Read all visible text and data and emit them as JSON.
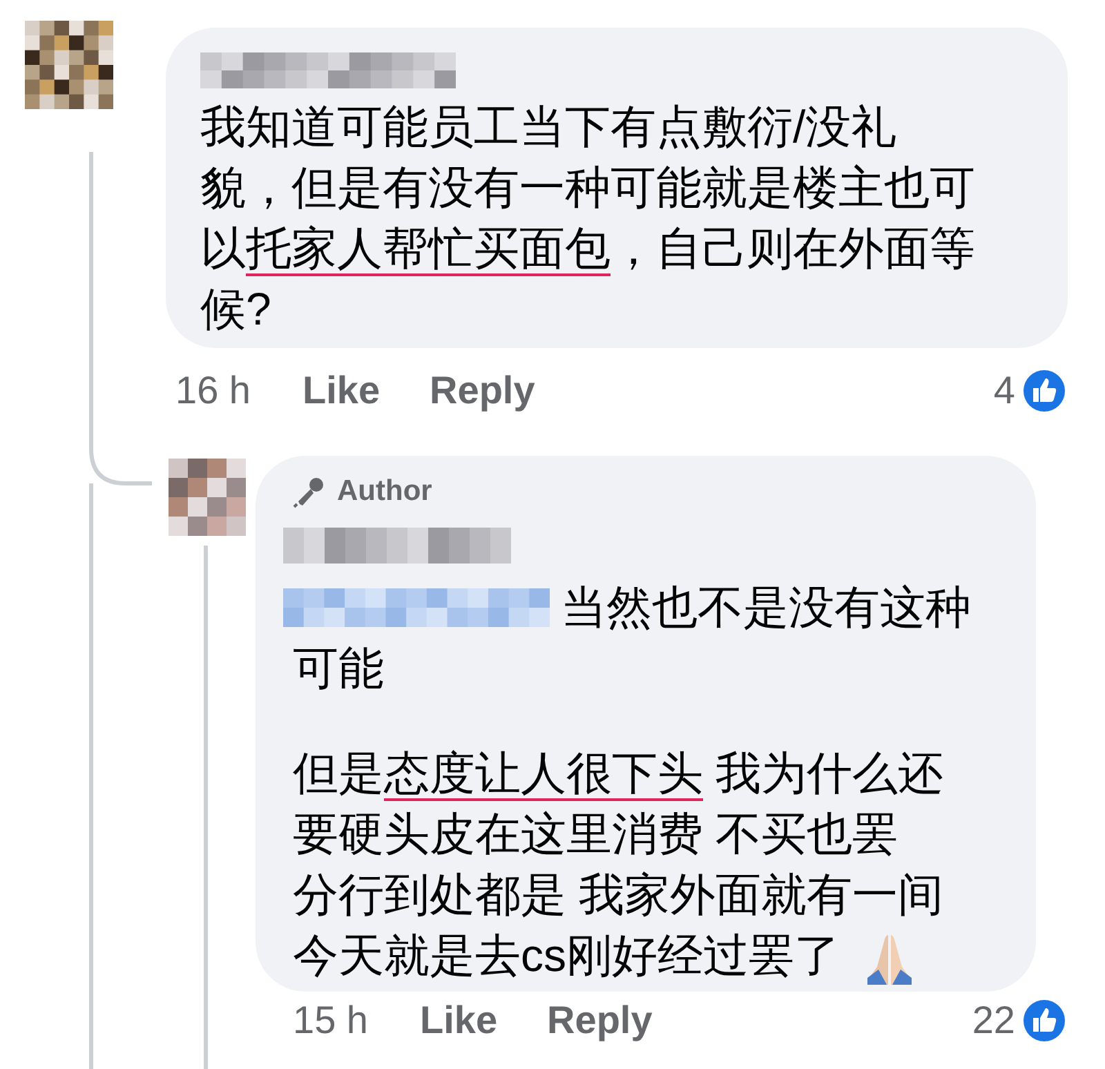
{
  "comments": [
    {
      "mention": false,
      "blocks": [
        {
          "kind": "text",
          "lines": [
            [
              {
                "text": "我知道可能员工当下有点敷衍/没礼",
                "underlined": false
              }
            ],
            [
              {
                "text": "貌，但是有没有一种可能就是楼主也可",
                "underlined": false
              }
            ],
            [
              {
                "text": "以",
                "underlined": false
              },
              {
                "text": "托家人帮忙买面包",
                "underlined": true
              },
              {
                "text": "，自己则在外面等",
                "underlined": false
              }
            ],
            [
              {
                "text": "候?",
                "underlined": false
              }
            ]
          ]
        }
      ],
      "time": "16 h",
      "like": "Like",
      "reply": "Reply",
      "reactions": "4"
    },
    {
      "author_badge": "Author",
      "mention": true,
      "blocks": [
        {
          "kind": "text",
          "lines": [
            [
              {
                "text": "当然也不是没有这种",
                "underlined": false
              }
            ],
            [
              {
                "text": "可能",
                "underlined": false
              }
            ]
          ]
        },
        {
          "kind": "text",
          "lines": [
            [
              {
                "text": "但是",
                "underlined": false
              },
              {
                "text": "态度让人很下头",
                "underlined": true
              },
              {
                "text": " 我为什么还",
                "underlined": false
              }
            ],
            [
              {
                "text": "要硬头皮在这里消费 不买也罢",
                "underlined": false
              }
            ],
            [
              {
                "text": "分行到处都是 我家外面就有一间",
                "underlined": false
              }
            ]
          ]
        },
        {
          "kind": "emoji_line",
          "lines": [
            [
              {
                "text": "今天就是去cs刚好经过罢了",
                "underlined": false
              }
            ]
          ]
        }
      ],
      "time": "15 h",
      "like": "Like",
      "reply": "Reply",
      "reactions": "22"
    }
  ]
}
